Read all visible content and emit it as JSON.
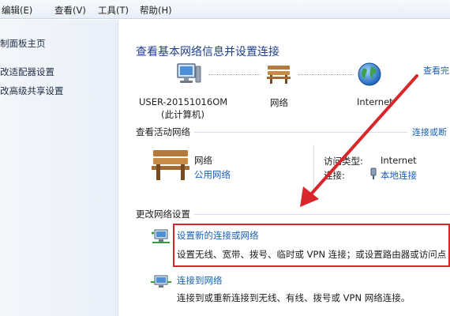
{
  "menu": {
    "edit": "编辑(E)",
    "view": "查看(V)",
    "tools": "工具(T)",
    "help": "帮助(H)"
  },
  "sidebar": {
    "items": [
      {
        "label": "制面板主页"
      },
      {
        "label": "改适配器设置"
      },
      {
        "label": "改高级共享设置"
      }
    ]
  },
  "main": {
    "title": "查看基本网络信息并设置连接",
    "view_full_map": "查看完",
    "map": {
      "computer_name": "USER-20151016OM",
      "computer_sub": "(此计算机)",
      "network": "网络",
      "internet": "Internet"
    },
    "active_networks": {
      "heading": "查看活动网络",
      "connect_or_disconnect": "连接或断",
      "network_name": "网络",
      "network_type": "公用网络",
      "access_type_label": "访问类型:",
      "access_type_value": "Internet",
      "connection_label": "连接:",
      "connection_value": "本地连接"
    },
    "change_settings": {
      "heading": "更改网络设置",
      "tasks": [
        {
          "title": "设置新的连接或网络",
          "desc": "设置无线、宽带、拨号、临时或 VPN 连接；或设置路由器或访问点"
        },
        {
          "title": "连接到网络",
          "desc": "连接到或重新连接到无线、有线、拨号或 VPN 网络连接。"
        }
      ]
    }
  },
  "colors": {
    "link": "#1a5fb4",
    "title": "#1e3d8a",
    "annotation_red": "#d9262b"
  }
}
